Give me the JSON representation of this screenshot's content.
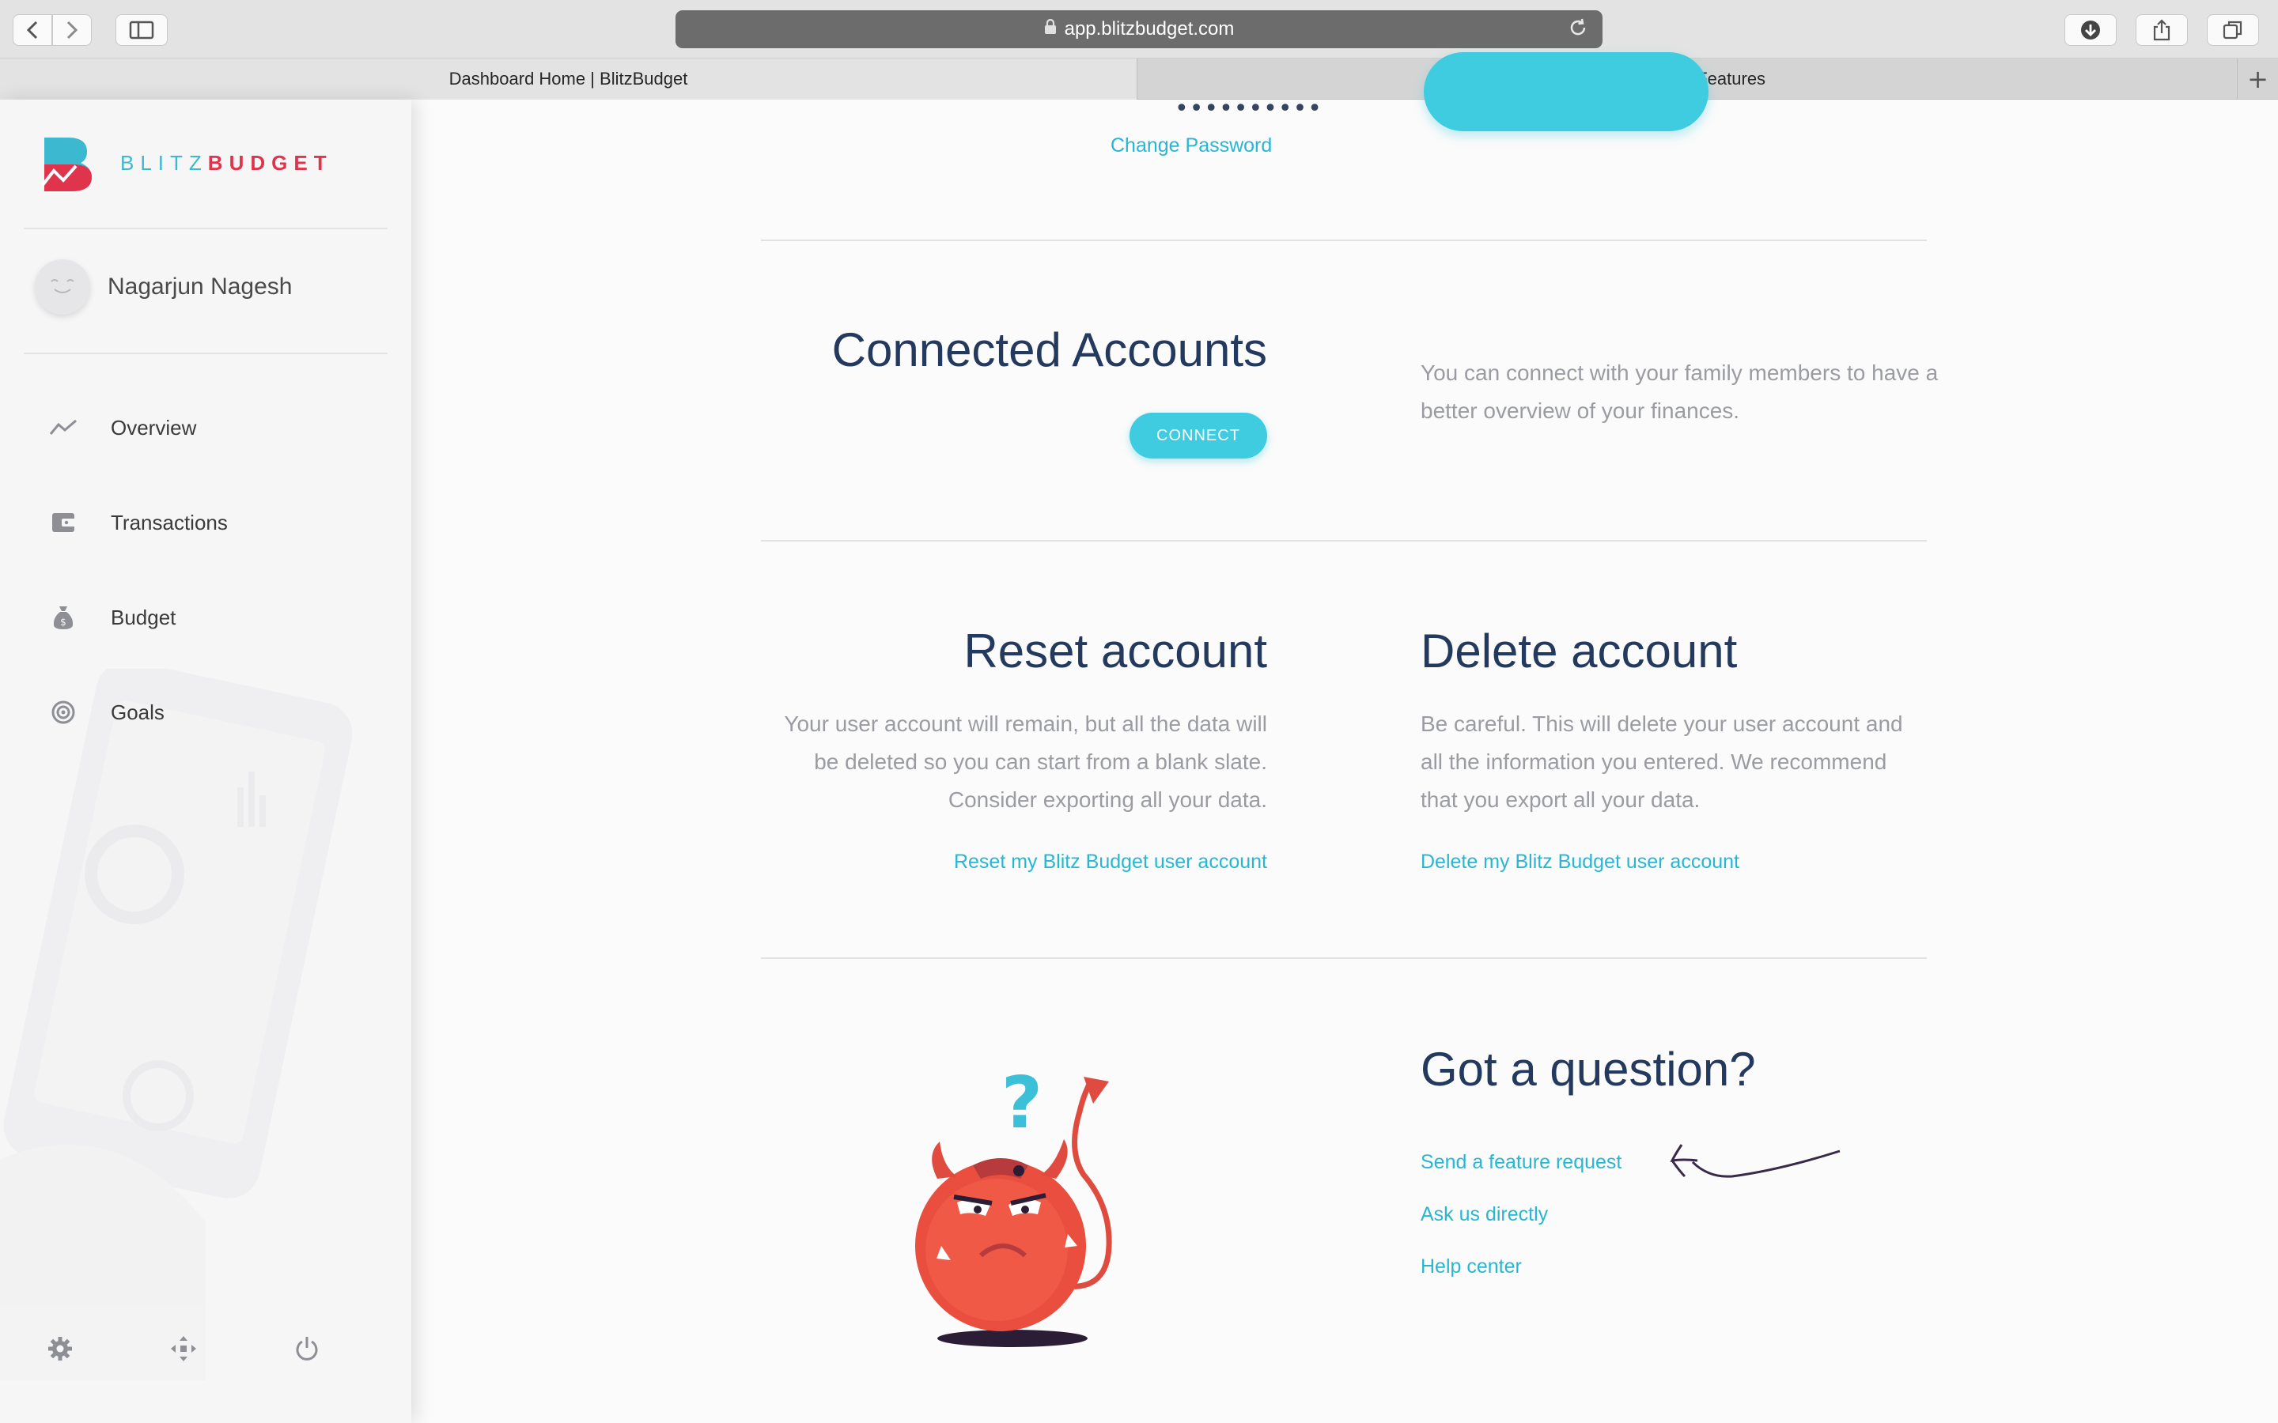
{
  "browser": {
    "url": "app.blitzbudget.com",
    "tabs": [
      {
        "label": "Dashboard Home | BlitzBudget",
        "active": true
      },
      {
        "label": "Suggested Features",
        "active": false
      }
    ]
  },
  "sidebar": {
    "logo": {
      "part1": "BLITZ",
      "part2": "BUDGET"
    },
    "user_name": "Nagarjun Nagesh",
    "items": [
      {
        "label": "Overview",
        "icon": "trend-icon"
      },
      {
        "label": "Transactions",
        "icon": "wallet-icon"
      },
      {
        "label": "Budget",
        "icon": "money-bag-icon"
      },
      {
        "label": "Goals",
        "icon": "target-icon"
      }
    ],
    "footer_icons": [
      "gear-icon",
      "arrows-icon",
      "power-icon"
    ]
  },
  "main": {
    "password_dots": "••••••••••",
    "change_password": "Change Password",
    "connected": {
      "title": "Connected Accounts",
      "button": "CONNECT",
      "description": "You can connect with your family members to have a better overview of your finances."
    },
    "reset": {
      "title": "Reset account",
      "description": "Your user account will remain, but all the data will be deleted so you can start from a blank slate. Consider exporting all your data.",
      "link": "Reset my Blitz Budget user account"
    },
    "delete": {
      "title": "Delete account",
      "description": "Be careful. This will delete your user account and all the information you entered. We recommend that you export all your data.",
      "link": "Delete my Blitz Budget user account"
    },
    "question": {
      "title": "Got a question?",
      "links": [
        "Send a feature request",
        "Ask us directly",
        "Help center"
      ]
    }
  },
  "colors": {
    "accent": "#3fcbe0",
    "link": "#27b7d3",
    "heading": "#23395d",
    "brand_red": "#e0344d"
  }
}
